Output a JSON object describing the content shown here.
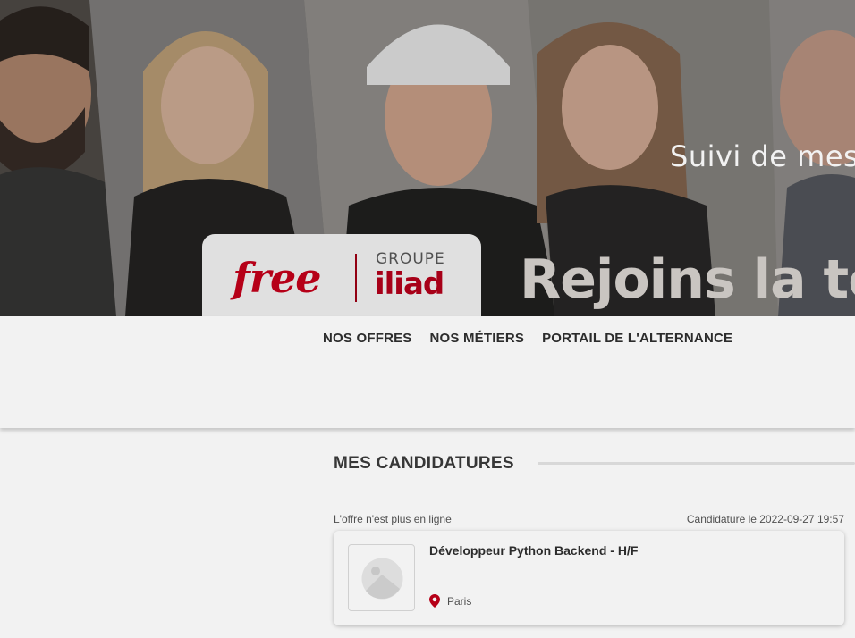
{
  "hero": {
    "subtitle": "Suivi de mes",
    "brand": {
      "free": "free",
      "groupe": "GROUPE",
      "iliad": "iliad"
    },
    "slogan": "Rejoins la team",
    "colors": {
      "brand_red": "#c0001a"
    }
  },
  "nav": {
    "links": [
      {
        "label": "NOS OFFRES"
      },
      {
        "label": "NOS MÉTIERS"
      },
      {
        "label": "PORTAIL DE L'ALTERNANCE"
      }
    ]
  },
  "applications": {
    "title": "MES CANDIDATURES",
    "items": [
      {
        "status": "L'offre n'est plus en ligne",
        "applied_at": "Candidature le 2022-09-27 19:57",
        "job_title": "Développeur Python Backend - H/F",
        "location": "Paris",
        "location_icon": "map-pin-icon",
        "thumbnail_icon": "image-placeholder-icon"
      }
    ]
  }
}
